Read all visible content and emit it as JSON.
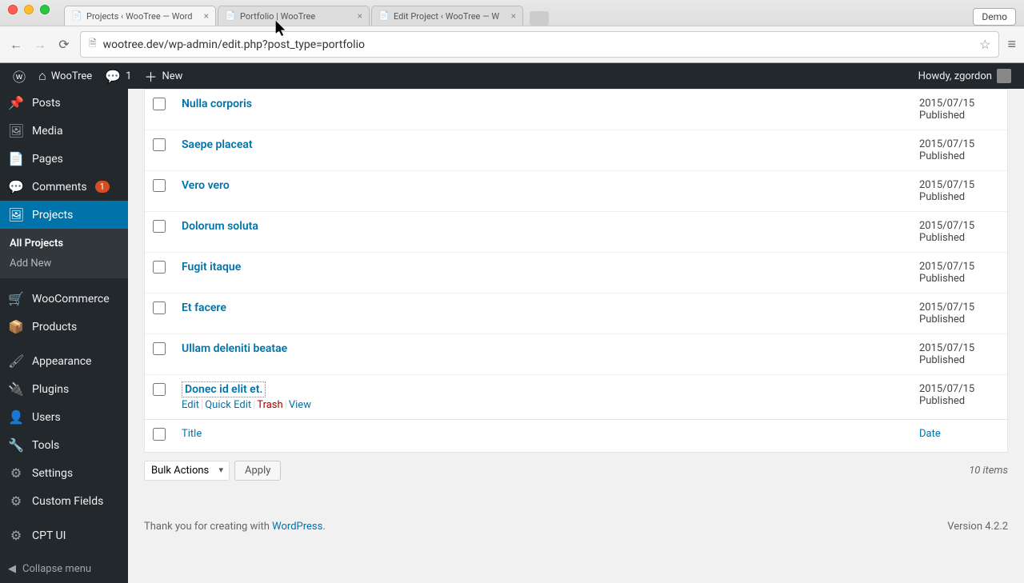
{
  "browser": {
    "tabs": [
      {
        "title": "Projects ‹ WooTree — Word"
      },
      {
        "title": "Portfolio | WooTree"
      },
      {
        "title": "Edit Project ‹ WooTree — W"
      }
    ],
    "url": "wootree.dev/wp-admin/edit.php?post_type=portfolio",
    "demo": "Demo"
  },
  "adminbar": {
    "site": "WooTree",
    "comments": "1",
    "new": "New",
    "howdy": "Howdy, zgordon"
  },
  "sidebar": {
    "posts": "Posts",
    "media": "Media",
    "pages": "Pages",
    "comments": "Comments",
    "comments_badge": "1",
    "projects": "Projects",
    "all_projects": "All Projects",
    "add_new": "Add New",
    "woocommerce": "WooCommerce",
    "products": "Products",
    "appearance": "Appearance",
    "plugins": "Plugins",
    "users": "Users",
    "tools": "Tools",
    "settings": "Settings",
    "custom_fields": "Custom Fields",
    "cpt_ui": "CPT UI",
    "collapse": "Collapse menu"
  },
  "table": {
    "rows": [
      {
        "title": "Nulla corporis",
        "date": "2015/07/15",
        "status": "Published",
        "partial": true
      },
      {
        "title": "Saepe placeat",
        "date": "2015/07/15",
        "status": "Published"
      },
      {
        "title": "Vero vero",
        "date": "2015/07/15",
        "status": "Published"
      },
      {
        "title": "Dolorum soluta",
        "date": "2015/07/15",
        "status": "Published"
      },
      {
        "title": "Fugit itaque",
        "date": "2015/07/15",
        "status": "Published"
      },
      {
        "title": "Et facere",
        "date": "2015/07/15",
        "status": "Published"
      },
      {
        "title": "Ullam deleniti beatae",
        "date": "2015/07/15",
        "status": "Published"
      },
      {
        "title": "Donec id elit et.",
        "date": "2015/07/15",
        "status": "Published",
        "hovered": true
      }
    ],
    "actions": {
      "edit": "Edit",
      "quick_edit": "Quick Edit",
      "trash": "Trash",
      "view": "View"
    },
    "footer": {
      "title": "Title",
      "date": "Date"
    },
    "bulk": "Bulk Actions",
    "apply": "Apply",
    "count": "10 items"
  },
  "footer": {
    "thanks_pre": "Thank you for creating with ",
    "thanks_link": "WordPress",
    "version": "Version 4.2.2"
  }
}
